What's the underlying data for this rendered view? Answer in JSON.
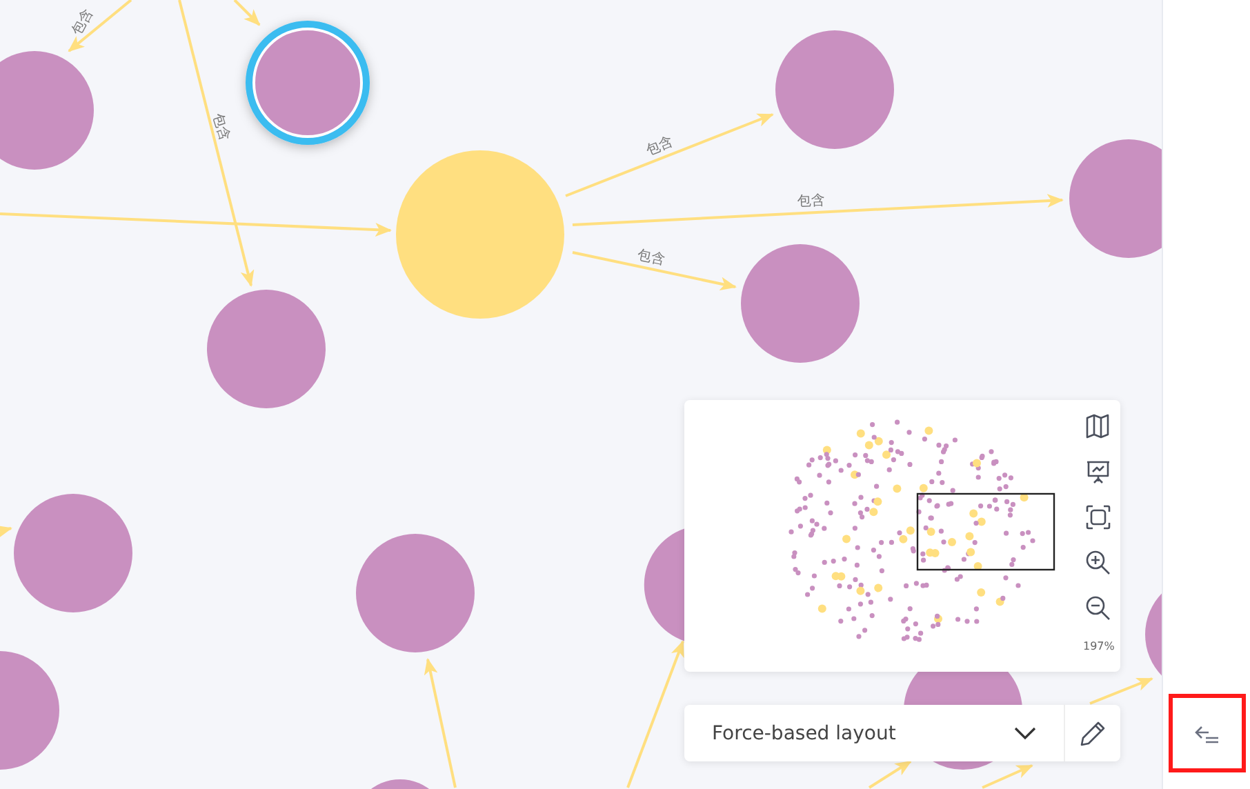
{
  "graph": {
    "nodes": [
      {
        "color": "#c990c0",
        "selected": false
      },
      {
        "color": "#c990c0",
        "selected": true
      },
      {
        "color": "#ffdf80",
        "selected": false
      },
      {
        "color": "#c990c0",
        "selected": false
      },
      {
        "color": "#c990c0",
        "selected": false
      },
      {
        "color": "#c990c0",
        "selected": false
      },
      {
        "color": "#c990c0",
        "selected": false
      },
      {
        "color": "#c990c0",
        "selected": false
      },
      {
        "color": "#c990c0",
        "selected": false
      },
      {
        "color": "#c990c0",
        "selected": false
      },
      {
        "color": "#c990c0",
        "selected": false
      },
      {
        "color": "#c990c0",
        "selected": false
      },
      {
        "color": "#c990c0",
        "selected": false
      },
      {
        "color": "#c990c0",
        "selected": false
      }
    ],
    "edge_labels": [
      "包含",
      "包含",
      "包含",
      "包含",
      "包含"
    ]
  },
  "minimap": {
    "zoom": "197%"
  },
  "layout_select": {
    "value": "Force-based layout"
  },
  "side_panel": {
    "toggle": {
      "highlighted": true
    }
  }
}
